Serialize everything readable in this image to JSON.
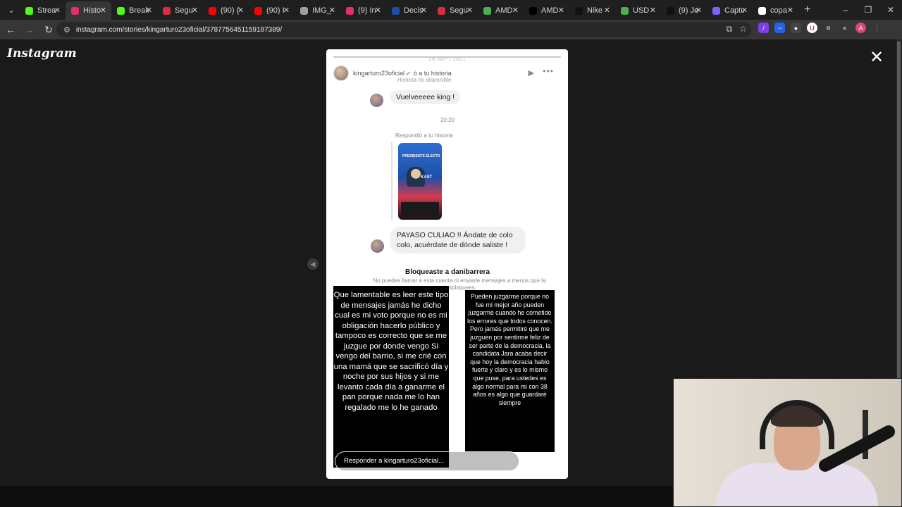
{
  "browser": {
    "tabs": [
      {
        "label": "Strea",
        "color": "#53fc18",
        "active": false
      },
      {
        "label": "Histo",
        "color": "#e1306c",
        "active": true
      },
      {
        "label": "Break",
        "color": "#53fc18",
        "active": false
      },
      {
        "label": "Segu",
        "color": "#d6303f",
        "active": false
      },
      {
        "label": "(90) (",
        "color": "#ff0000",
        "active": false
      },
      {
        "label": "(90) I",
        "color": "#ff0000",
        "active": false
      },
      {
        "label": "IMG_",
        "color": "#9aa0a6",
        "active": false
      },
      {
        "label": "(9) In",
        "color": "#e1306c",
        "active": false
      },
      {
        "label": "Decis",
        "color": "#1a4fa3",
        "active": false
      },
      {
        "label": "Segu",
        "color": "#d6303f",
        "active": false
      },
      {
        "label": "AMD",
        "color": "#4caf50",
        "active": false
      },
      {
        "label": "AMD",
        "color": "#000000",
        "active": false
      },
      {
        "label": "Nike",
        "color": "#111111",
        "active": false
      },
      {
        "label": "USD",
        "color": "#4caf50",
        "active": false
      },
      {
        "label": "(9) Je",
        "color": "#111111",
        "active": false
      },
      {
        "label": "Captu",
        "color": "#7b61ff",
        "active": false
      },
      {
        "label": "copa",
        "color": "#ffffff",
        "active": false
      }
    ],
    "url": "instagram.com/stories/kingarturo23oficial/3787756451159187389/"
  },
  "instagram": {
    "logo": "Instagram",
    "story": {
      "progress": 1.0,
      "date_label": "26 SEPT 2021",
      "username": "kingarturo23oficial",
      "header_overlay": "ó a tu historia",
      "story_unavailable": "Historia no disponible",
      "chat": {
        "message1": "Vuelveeeee king !",
        "time": "20:20",
        "replied_label": "Respondió a tu historia",
        "thumb_text": "PRESIDENTE ELECTO",
        "thumb_name": "KAST",
        "message2": "PAYASO CULIAO !! Ándate de colo colo, acuérdate de dónde saliste !",
        "blocked_title": "Bloqueaste a danibarrera",
        "blocked_subtitle": "No puedes llamar a esta cuenta ni enviarle mensajes a menos que la desbloquees."
      },
      "left_text": "Que lamentable es leer este tipo de mensajes jamás he dicho cual es mi voto porque no es mi obligación hacerlo público y tampoco es correcto que se me juzgue por donde vengo Si vengo del barrio, si me crié con una mamá que se sacrificó día y noche por sus hijos y si me levanto cada día a ganarme el pan porque nada me lo han regalado me lo he ganado",
      "right_text": "Pueden juzgarme porque no fue mi mejor año pueden juzgarme cuando he cometido los errores que todos conocen. Pero jamás permitiré que me juzguen por sentirme feliz de ser parte de la democracia, la candidata Jara acaba decir que hoy la democracia hablo fuerte y claro y es lo mismo que puse, para ustedes es algo normal para mi con 38 años es algo que guardaré siempre",
      "reply_placeholder": "Responder a kingarturo23oficial..."
    }
  }
}
